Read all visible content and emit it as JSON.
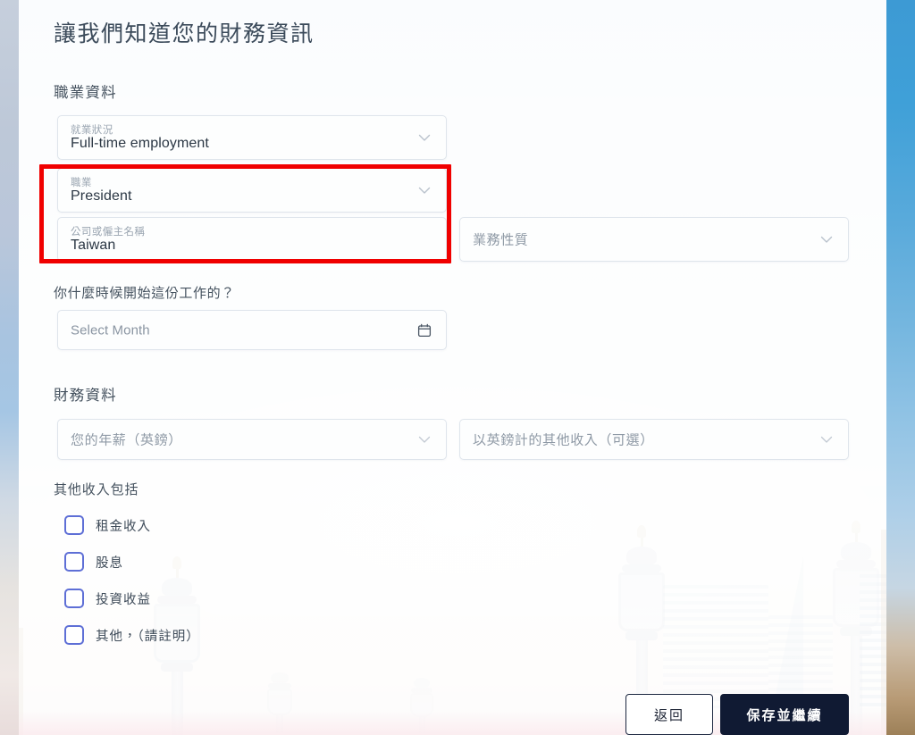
{
  "page": {
    "title": "讓我們知道您的財務資訊"
  },
  "sections": {
    "occupation_heading": "職業資料",
    "financial_heading": "財務資料",
    "start_date_question": "你什麼時候開始這份工作的？",
    "other_income_heading": "其他收入包括"
  },
  "fields": {
    "employment_status": {
      "label": "就業狀況",
      "value": "Full-time employment",
      "icon": "chevron-down-icon"
    },
    "occupation": {
      "label": "職業",
      "value": "President",
      "icon": "chevron-down-icon"
    },
    "employer_name": {
      "label": "公司或僱主名稱",
      "value": "Taiwan"
    },
    "business_nature": {
      "placeholder": "業務性質",
      "icon": "chevron-down-icon"
    },
    "start_month": {
      "placeholder": "Select Month",
      "icon": "calendar-icon"
    },
    "annual_salary": {
      "placeholder": "您的年薪（英鎊）",
      "icon": "chevron-down-icon"
    },
    "other_income": {
      "placeholder": "以英鎊計的其他收入（可選）",
      "icon": "chevron-down-icon"
    }
  },
  "checkboxes": [
    {
      "label": "租金收入",
      "checked": false
    },
    {
      "label": "股息",
      "checked": false
    },
    {
      "label": "投資收益",
      "checked": false
    },
    {
      "label": "其他，（請註明）",
      "checked": false
    }
  ],
  "buttons": {
    "back": "返回",
    "save_continue": "保存並繼續"
  },
  "annotation": {
    "highlight_color": "#f00000",
    "highlight_target": "occupation-and-employer-fields"
  },
  "colors": {
    "title_text": "#3b4a5a",
    "field_border": "#dfe5ec",
    "field_label": "#9aa5b1",
    "field_value": "#2b3744",
    "checkbox_border": "#5e6fd6",
    "primary_button_bg": "#101a33",
    "secondary_button_border": "#1c2740",
    "annotation_red": "#f00000"
  }
}
